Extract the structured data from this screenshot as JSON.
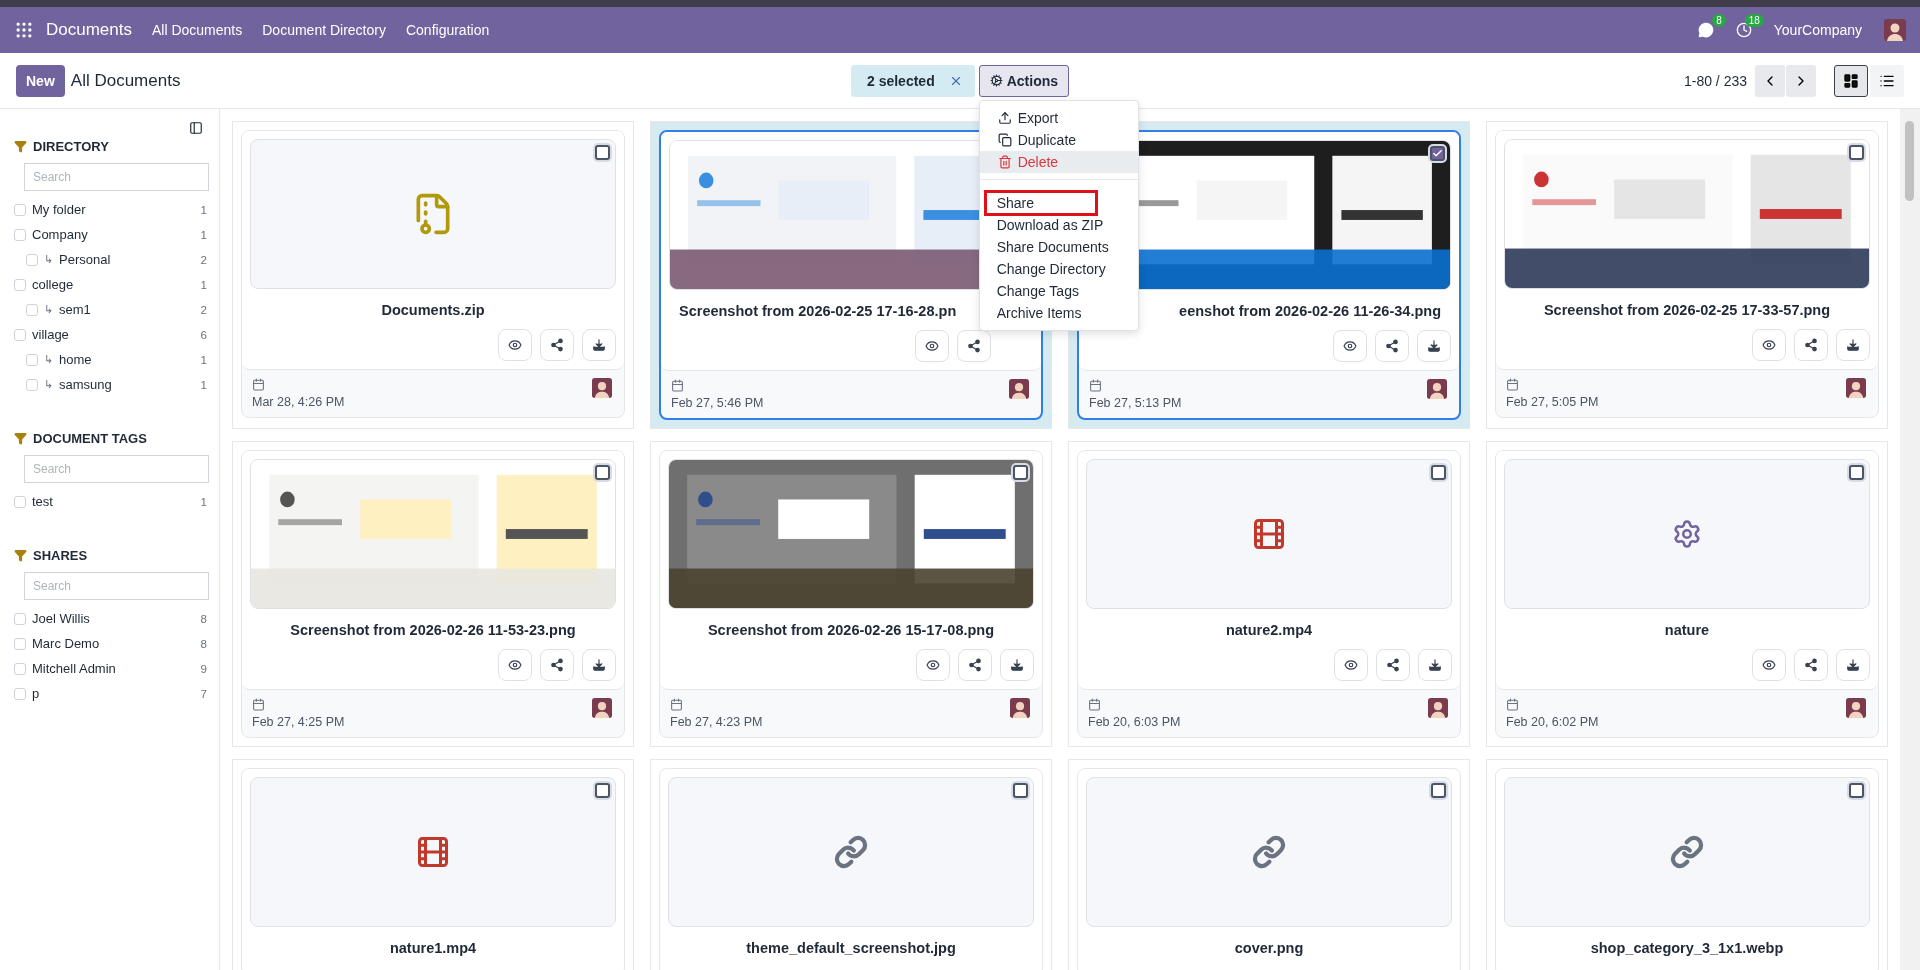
{
  "navbar": {
    "app_title": "Documents",
    "menu": [
      "All Documents",
      "Document Directory",
      "Configuration"
    ],
    "messages_badge": "8",
    "activities_badge": "18",
    "company": "YourCompany"
  },
  "control_bar": {
    "new_button": "New",
    "breadcrumb": "All Documents",
    "selection": "2 selected",
    "actions_button": "Actions",
    "pager": "1-80 / 233",
    "views": [
      {
        "kind": "kanban",
        "selected": true
      },
      {
        "kind": "list",
        "selected": false
      }
    ]
  },
  "actions_menu": {
    "groups": [
      [
        {
          "label": "Export",
          "danger": false,
          "hovered": false
        },
        {
          "label": "Duplicate",
          "danger": false,
          "hovered": false
        },
        {
          "label": "Delete",
          "danger": true,
          "hovered": true
        }
      ],
      [
        {
          "label": "Share",
          "outlined": true
        },
        {
          "label": "Download as ZIP",
          "outlined": false
        },
        {
          "label": "Share Documents",
          "outlined": false
        },
        {
          "label": "Change Directory",
          "outlined": false
        },
        {
          "label": "Change Tags",
          "outlined": false
        },
        {
          "label": "Archive Items",
          "outlined": false
        }
      ]
    ]
  },
  "sidebar": {
    "sections": [
      {
        "title": "DIRECTORY",
        "search_placeholder": "Search",
        "items": [
          {
            "label": "My folder",
            "count": "1",
            "checked": false
          },
          {
            "label": "Company",
            "count": "1",
            "checked": false,
            "children": [
              {
                "marker": "↳",
                "label": "Personal",
                "count": "2",
                "checked": false
              }
            ]
          },
          {
            "label": "college",
            "count": "1",
            "checked": false,
            "children": [
              {
                "marker": "↳",
                "label": "sem1",
                "count": "2",
                "checked": false
              }
            ]
          },
          {
            "label": "village",
            "count": "6",
            "checked": false,
            "children": [
              {
                "marker": "↳",
                "label": "home",
                "count": "1",
                "checked": false
              },
              {
                "marker": "↳",
                "label": "samsung",
                "count": "1",
                "checked": false
              }
            ]
          }
        ]
      },
      {
        "title": "DOCUMENT TAGS",
        "search_placeholder": "Search",
        "items": [
          {
            "label": "test",
            "count": "1",
            "checked": false
          }
        ]
      },
      {
        "title": "SHARES",
        "search_placeholder": "Search",
        "items": [
          {
            "label": "Joel Willis",
            "count": "8",
            "checked": false
          },
          {
            "label": "Marc Demo",
            "count": "8",
            "checked": false
          },
          {
            "label": "Mitchell Admin",
            "count": "9",
            "checked": false
          },
          {
            "label": "p",
            "count": "7",
            "checked": false
          }
        ]
      }
    ]
  },
  "cards": [
    {
      "name": "Documents.zip",
      "kind": "zip",
      "selected": false,
      "checked": false,
      "date": "Mar 28, 4:26 PM",
      "download_hidden": false
    },
    {
      "name": "Screenshot from 2026-02-25 17-16-28.pn",
      "cut_at_end": true,
      "kind": "picture",
      "selected": true,
      "date": "Feb 27, 5:46 PM",
      "download_hidden": true
    },
    {
      "name": "eenshot from 2026-02-26 11-26-34.png",
      "cut_at_start": true,
      "kind": "picture",
      "selected": true,
      "checked": true,
      "date": "Feb 27, 5:13 PM",
      "download_hidden": false
    },
    {
      "name": "Screenshot from 2026-02-25 17-33-57.png",
      "kind": "picture",
      "selected": false,
      "checked": false,
      "date": "Feb 27, 5:05 PM",
      "download_hidden": false
    },
    {
      "name": "Screenshot from 2026-02-26 11-53-23.png",
      "kind": "picture",
      "selected": false,
      "checked": false,
      "date": "Feb 27, 4:25 PM",
      "download_hidden": false
    },
    {
      "name": "Screenshot from 2026-02-26 15-17-08.png",
      "kind": "picture",
      "selected": false,
      "checked": false,
      "date": "Feb 27, 4:23 PM",
      "download_hidden": false
    },
    {
      "name": "nature2.mp4",
      "kind": "video",
      "selected": false,
      "checked": false,
      "date": "Feb 20, 6:03 PM",
      "download_hidden": false
    },
    {
      "name": "nature",
      "kind": "gear",
      "selected": false,
      "checked": false,
      "date": "Feb 20, 6:02 PM",
      "download_hidden": false
    },
    {
      "name": "nature1.mp4",
      "kind": "video",
      "selected": false,
      "checked": false
    },
    {
      "name": "theme_default_screenshot.jpg",
      "kind": "link",
      "selected": false,
      "checked": false
    },
    {
      "name": "cover.png",
      "kind": "link",
      "selected": false,
      "checked": false
    },
    {
      "name": "shop_category_3_1x1.webp",
      "kind": "link",
      "selected": false,
      "checked": false
    }
  ]
}
